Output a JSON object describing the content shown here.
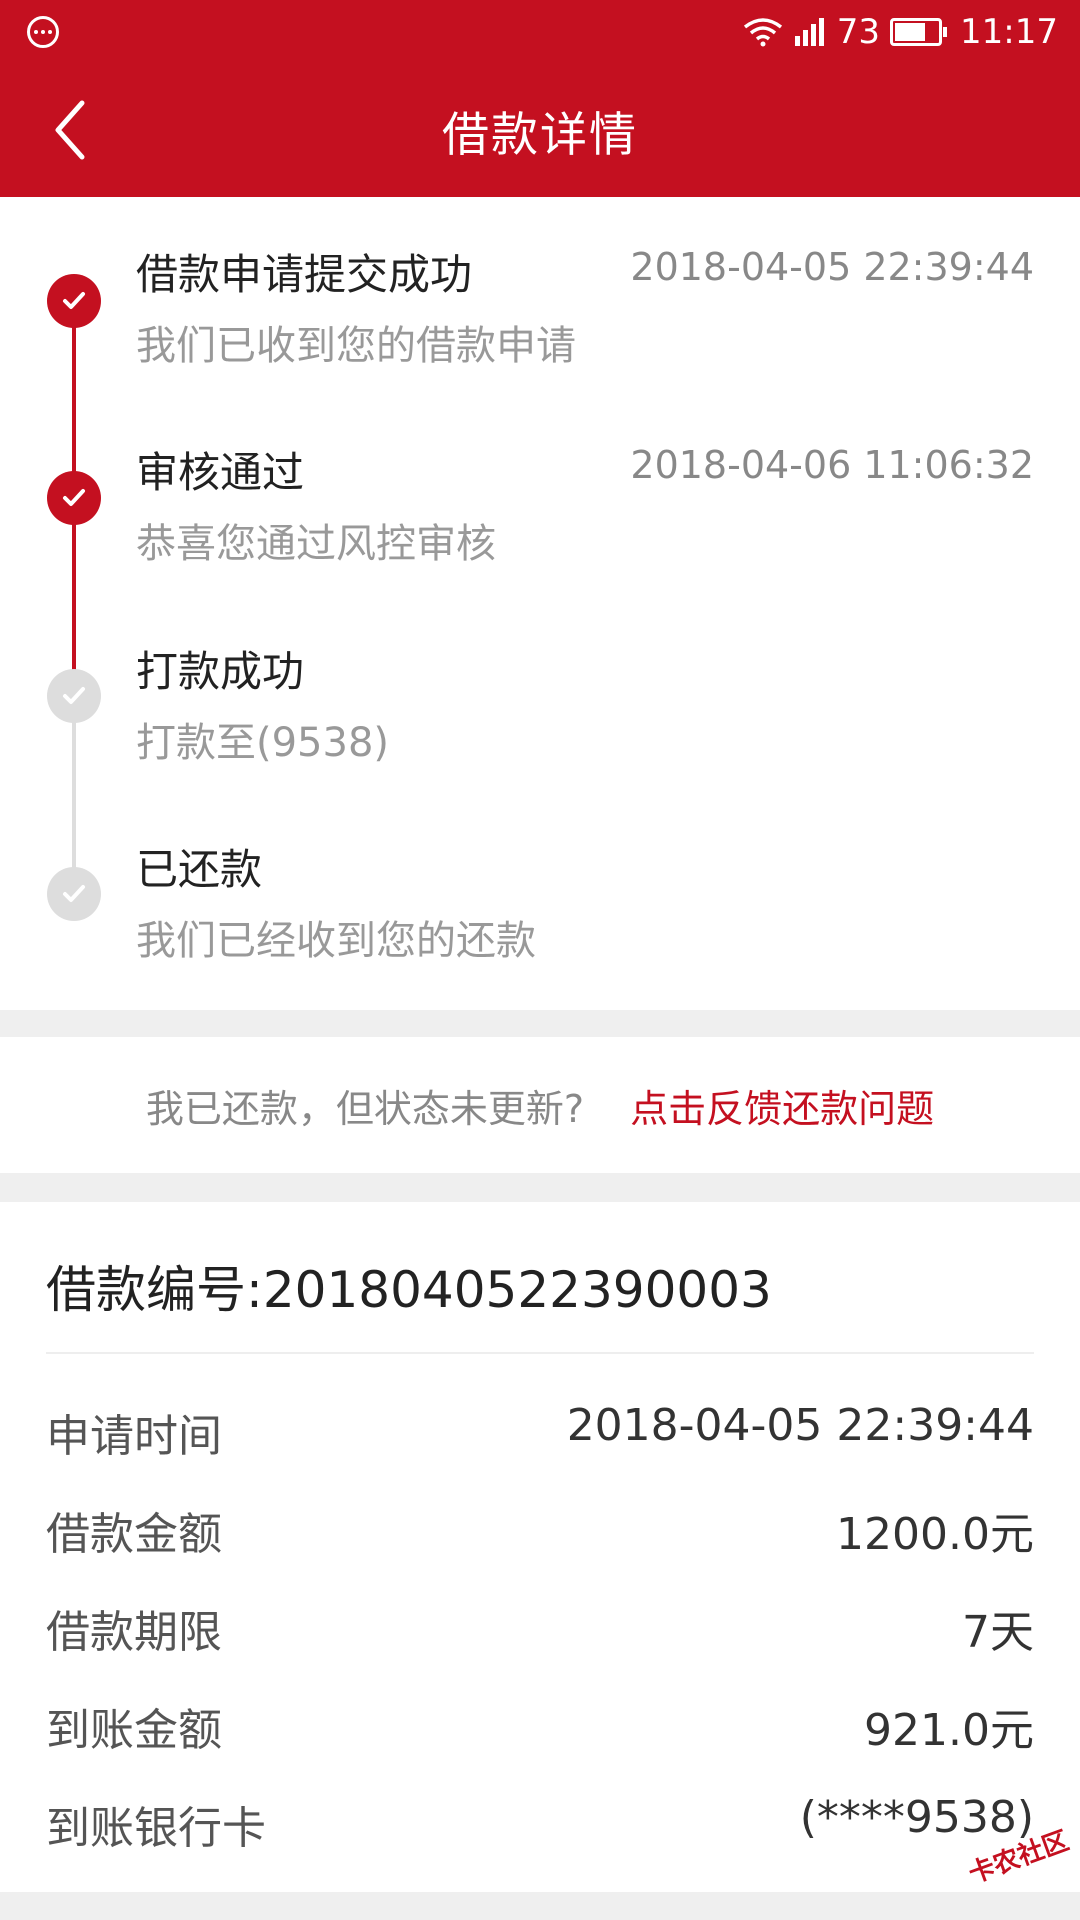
{
  "status_bar": {
    "signal_level": "73",
    "time": "11:17"
  },
  "header": {
    "title": "借款详情"
  },
  "timeline": [
    {
      "title": "借款申请提交成功",
      "time": "2018-04-05 22:39:44",
      "desc": "我们已收到您的借款申请",
      "state": "done"
    },
    {
      "title": "审核通过",
      "time": "2018-04-06 11:06:32",
      "desc": "恭喜您通过风控审核",
      "state": "done"
    },
    {
      "title": "打款成功",
      "time": "",
      "desc": "打款至(9538)",
      "state": "pending"
    },
    {
      "title": "已还款",
      "time": "",
      "desc": "我们已经收到您的还款",
      "state": "pending"
    }
  ],
  "feedback": {
    "question": "我已还款，但状态未更新?",
    "link": "点击反馈还款问题"
  },
  "details": {
    "loan_number": "借款编号:2018040522390003",
    "rows": [
      {
        "label": "申请时间",
        "value": "2018-04-05 22:39:44"
      },
      {
        "label": "借款金额",
        "value": "1200.0元"
      },
      {
        "label": "借款期限",
        "value": "7天"
      },
      {
        "label": "到账金额",
        "value": "921.0元"
      },
      {
        "label": "到账银行卡",
        "value": "(****9538)"
      }
    ]
  },
  "colors": {
    "brand": "#c41020",
    "pending": "#dddddd"
  },
  "watermark": "卡农社区"
}
